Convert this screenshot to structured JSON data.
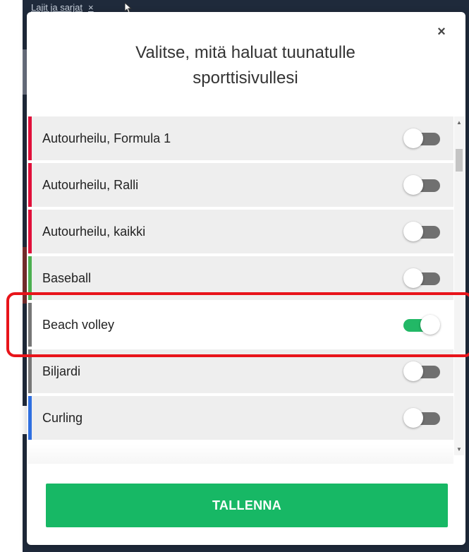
{
  "background": {
    "tab_label": "Lajit ja sarjat",
    "tab_close": "×"
  },
  "modal": {
    "close_symbol": "×",
    "title_line1": "Valitse, mitä haluat tuunatulle",
    "title_line2": "sporttisivullesi",
    "save_label": "TALLENNA",
    "items": [
      {
        "label": "Autourheilu, Formula 1",
        "on": false,
        "color": "#e0103a"
      },
      {
        "label": "Autourheilu, Ralli",
        "on": false,
        "color": "#e0103a"
      },
      {
        "label": "Autourheilu, kaikki",
        "on": false,
        "color": "#e0103a"
      },
      {
        "label": "Baseball",
        "on": false,
        "color": "#4caf50"
      },
      {
        "label": "Beach volley",
        "on": true,
        "color": "#777777"
      },
      {
        "label": "Biljardi",
        "on": false,
        "color": "#777777"
      },
      {
        "label": "Curling",
        "on": false,
        "color": "#2f6fe0"
      }
    ]
  },
  "colors": {
    "accent": "#17b865",
    "toggle_on": "#22b866",
    "toggle_off": "#707070",
    "highlight": "#e8141a"
  }
}
